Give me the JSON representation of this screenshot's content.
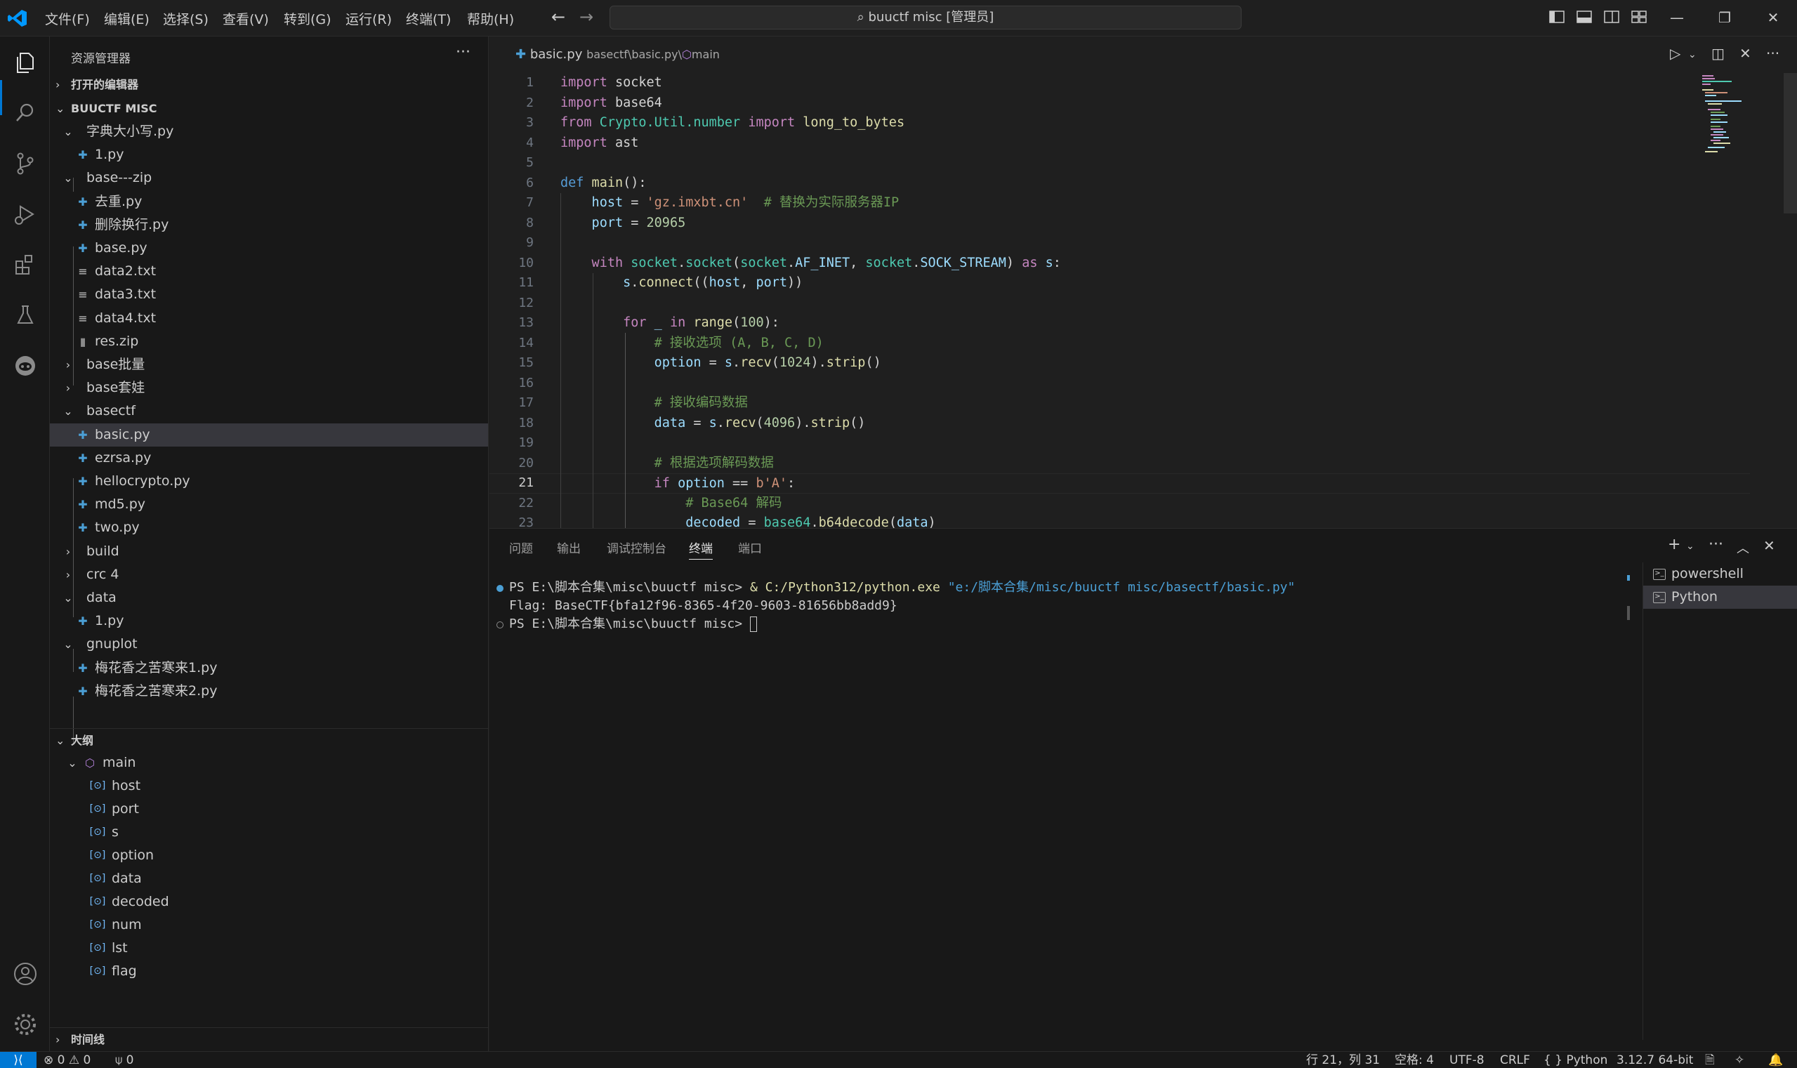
{
  "window": {
    "title": "buuctf misc [管理员]",
    "accent": "#0078d4"
  },
  "menu": [
    "文件(F)",
    "编辑(E)",
    "选择(S)",
    "查看(V)",
    "转到(G)",
    "运行(R)",
    "终端(T)",
    "帮助(H)"
  ],
  "sidebar": {
    "title": "资源管理器",
    "open_editors": "打开的编辑器",
    "folder": "BUUCTF MISC",
    "tree": [
      {
        "name": "字典大小写.py",
        "icon": "folder-open"
      },
      {
        "name": "1.py",
        "icon": "python-file"
      },
      {
        "name": "base---zip",
        "icon": "folder-open"
      },
      {
        "name": "去重.py",
        "icon": "python-file"
      },
      {
        "name": "删除换行.py",
        "icon": "python-file"
      },
      {
        "name": "base.py",
        "icon": "python-file"
      },
      {
        "name": "data2.txt",
        "icon": "text-file"
      },
      {
        "name": "data3.txt",
        "icon": "text-file"
      },
      {
        "name": "data4.txt",
        "icon": "text-file"
      },
      {
        "name": "res.zip",
        "icon": "zip-file"
      },
      {
        "name": "base批量",
        "icon": "folder-closed"
      },
      {
        "name": "base套娃",
        "icon": "folder-closed"
      },
      {
        "name": "basectf",
        "icon": "folder-open"
      },
      {
        "name": "basic.py",
        "icon": "python-file"
      },
      {
        "name": "ezrsa.py",
        "icon": "python-file"
      },
      {
        "name": "hellocrypto.py",
        "icon": "python-file"
      },
      {
        "name": "md5.py",
        "icon": "python-file"
      },
      {
        "name": "two.py",
        "icon": "python-file"
      },
      {
        "name": "build",
        "icon": "folder-closed"
      },
      {
        "name": "crc 4",
        "icon": "folder-closed"
      },
      {
        "name": "data",
        "icon": "folder-open"
      },
      {
        "name": "1.py",
        "icon": "python-file"
      },
      {
        "name": "gnuplot",
        "icon": "folder-open"
      },
      {
        "name": "梅花香之苦寒来1.py",
        "icon": "python-file"
      },
      {
        "name": "梅花香之苦寒来2.py",
        "icon": "python-file"
      }
    ],
    "outline_title": "大纲",
    "outline": {
      "root": "main",
      "vars": [
        "host",
        "port",
        "s",
        "option",
        "data",
        "decoded",
        "num",
        "lst",
        "flag"
      ]
    },
    "timeline_title": "时间线"
  },
  "editor": {
    "breadcrumb": {
      "file": "basic.py",
      "path": "basectf\\basic.py\\",
      "symbol": "main"
    },
    "current_line": 21,
    "line_numbers": [
      "1",
      "2",
      "3",
      "4",
      "5",
      "6",
      "7",
      "8",
      "9",
      "10",
      "11",
      "12",
      "13",
      "14",
      "15",
      "16",
      "17",
      "18",
      "19",
      "20",
      "21",
      "22",
      "23"
    ],
    "code": {
      "l1_kw": "import",
      "l1_mod": " socket",
      "l2_kw": "import",
      "l2_mod": " base64",
      "l3_from": "from",
      "l3_mod": " Crypto.Util.number ",
      "l3_imp": "import",
      "l3_name": " long_to_bytes",
      "l4_kw": "import",
      "l4_mod": " ast",
      "l6_def": "def",
      "l6_fn": " main",
      "l6_rest": "():",
      "l7_var": "    host",
      "l7_eq": " = ",
      "l7_str": "'gz.imxbt.cn'",
      "l7_cm": "  # 替换为实际服务器IP",
      "l8_var": "    port",
      "l8_eq": " = ",
      "l8_num": "20965",
      "l10_with": "    with",
      "l10_a": " socket",
      "l10_b": ".",
      "l10_fn": "socket",
      "l10_c": "(",
      "l10_d": "socket",
      "l10_e": ".",
      "l10_f": "AF_INET",
      "l10_g": ", ",
      "l10_h": "socket",
      "l10_i": ".",
      "l10_j": "SOCK_STREAM",
      "l10_k": ") ",
      "l10_as": "as",
      "l10_s": " s",
      "l10_end": ":",
      "l11_s": "        s",
      "l11_dot": ".",
      "l11_fn": "connect",
      "l11_a": "((",
      "l11_host": "host",
      "l11_c": ", ",
      "l11_port": "port",
      "l11_end": "))",
      "l13_for": "        for",
      "l13_u": " _ ",
      "l13_in": "in",
      "l13_fn": " range",
      "l13_a": "(",
      "l13_num": "100",
      "l13_end": "):",
      "l14_cm": "            # 接收选项 (A, B, C, D)",
      "l15_var": "            option",
      "l15_eq": " = ",
      "l15_s": "s",
      "l15_d": ".",
      "l15_fn": "recv",
      "l15_a": "(",
      "l15_num": "1024",
      "l15_b": ").",
      "l15_fn2": "strip",
      "l15_end": "()",
      "l17_cm": "            # 接收编码数据",
      "l18_var": "            data",
      "l18_eq": " = ",
      "l18_s": "s",
      "l18_d": ".",
      "l18_fn": "recv",
      "l18_a": "(",
      "l18_num": "4096",
      "l18_b": ").",
      "l18_fn2": "strip",
      "l18_end": "()",
      "l20_cm": "            # 根据选项解码数据",
      "l21_if": "            if",
      "l21_var": " option",
      "l21_eq": " == ",
      "l21_str": "b'A'",
      "l21_end": ":",
      "l22_cm": "                # Base64 解码",
      "l23_var": "                decoded",
      "l23_eq": " = ",
      "l23_mod": "base64",
      "l23_d": ".",
      "l23_fn": "b64decode",
      "l23_a": "(",
      "l23_arg": "data",
      "l23_end": ")"
    }
  },
  "panel": {
    "tabs": [
      "问题",
      "输出",
      "调试控制台",
      "终端",
      "端口"
    ],
    "active_tab": "终端",
    "terminal": {
      "l1_prompt": "PS E:\\脚本合集\\misc\\buuctf misc> ",
      "l1_amp": "& ",
      "l1_exe": "C:/Python312/python.exe",
      "l1_arg": " \"e:/脚本合集/misc/buuctf misc/basectf/basic.py\"",
      "l2": "Flag: BaseCTF{bfa12f96-8365-4f20-9603-81656bb8add9}",
      "l3_prompt": "PS E:\\脚本合集\\misc\\buuctf misc> "
    },
    "terminals": [
      "powershell",
      "Python"
    ]
  },
  "statusbar": {
    "errors": "0",
    "warnings": "0",
    "ports": "0",
    "position": "行 21，列 31",
    "spaces": "空格: 4",
    "encoding": "UTF-8",
    "eol": "CRLF",
    "language": "Python",
    "interpreter": "3.12.7 64-bit"
  }
}
